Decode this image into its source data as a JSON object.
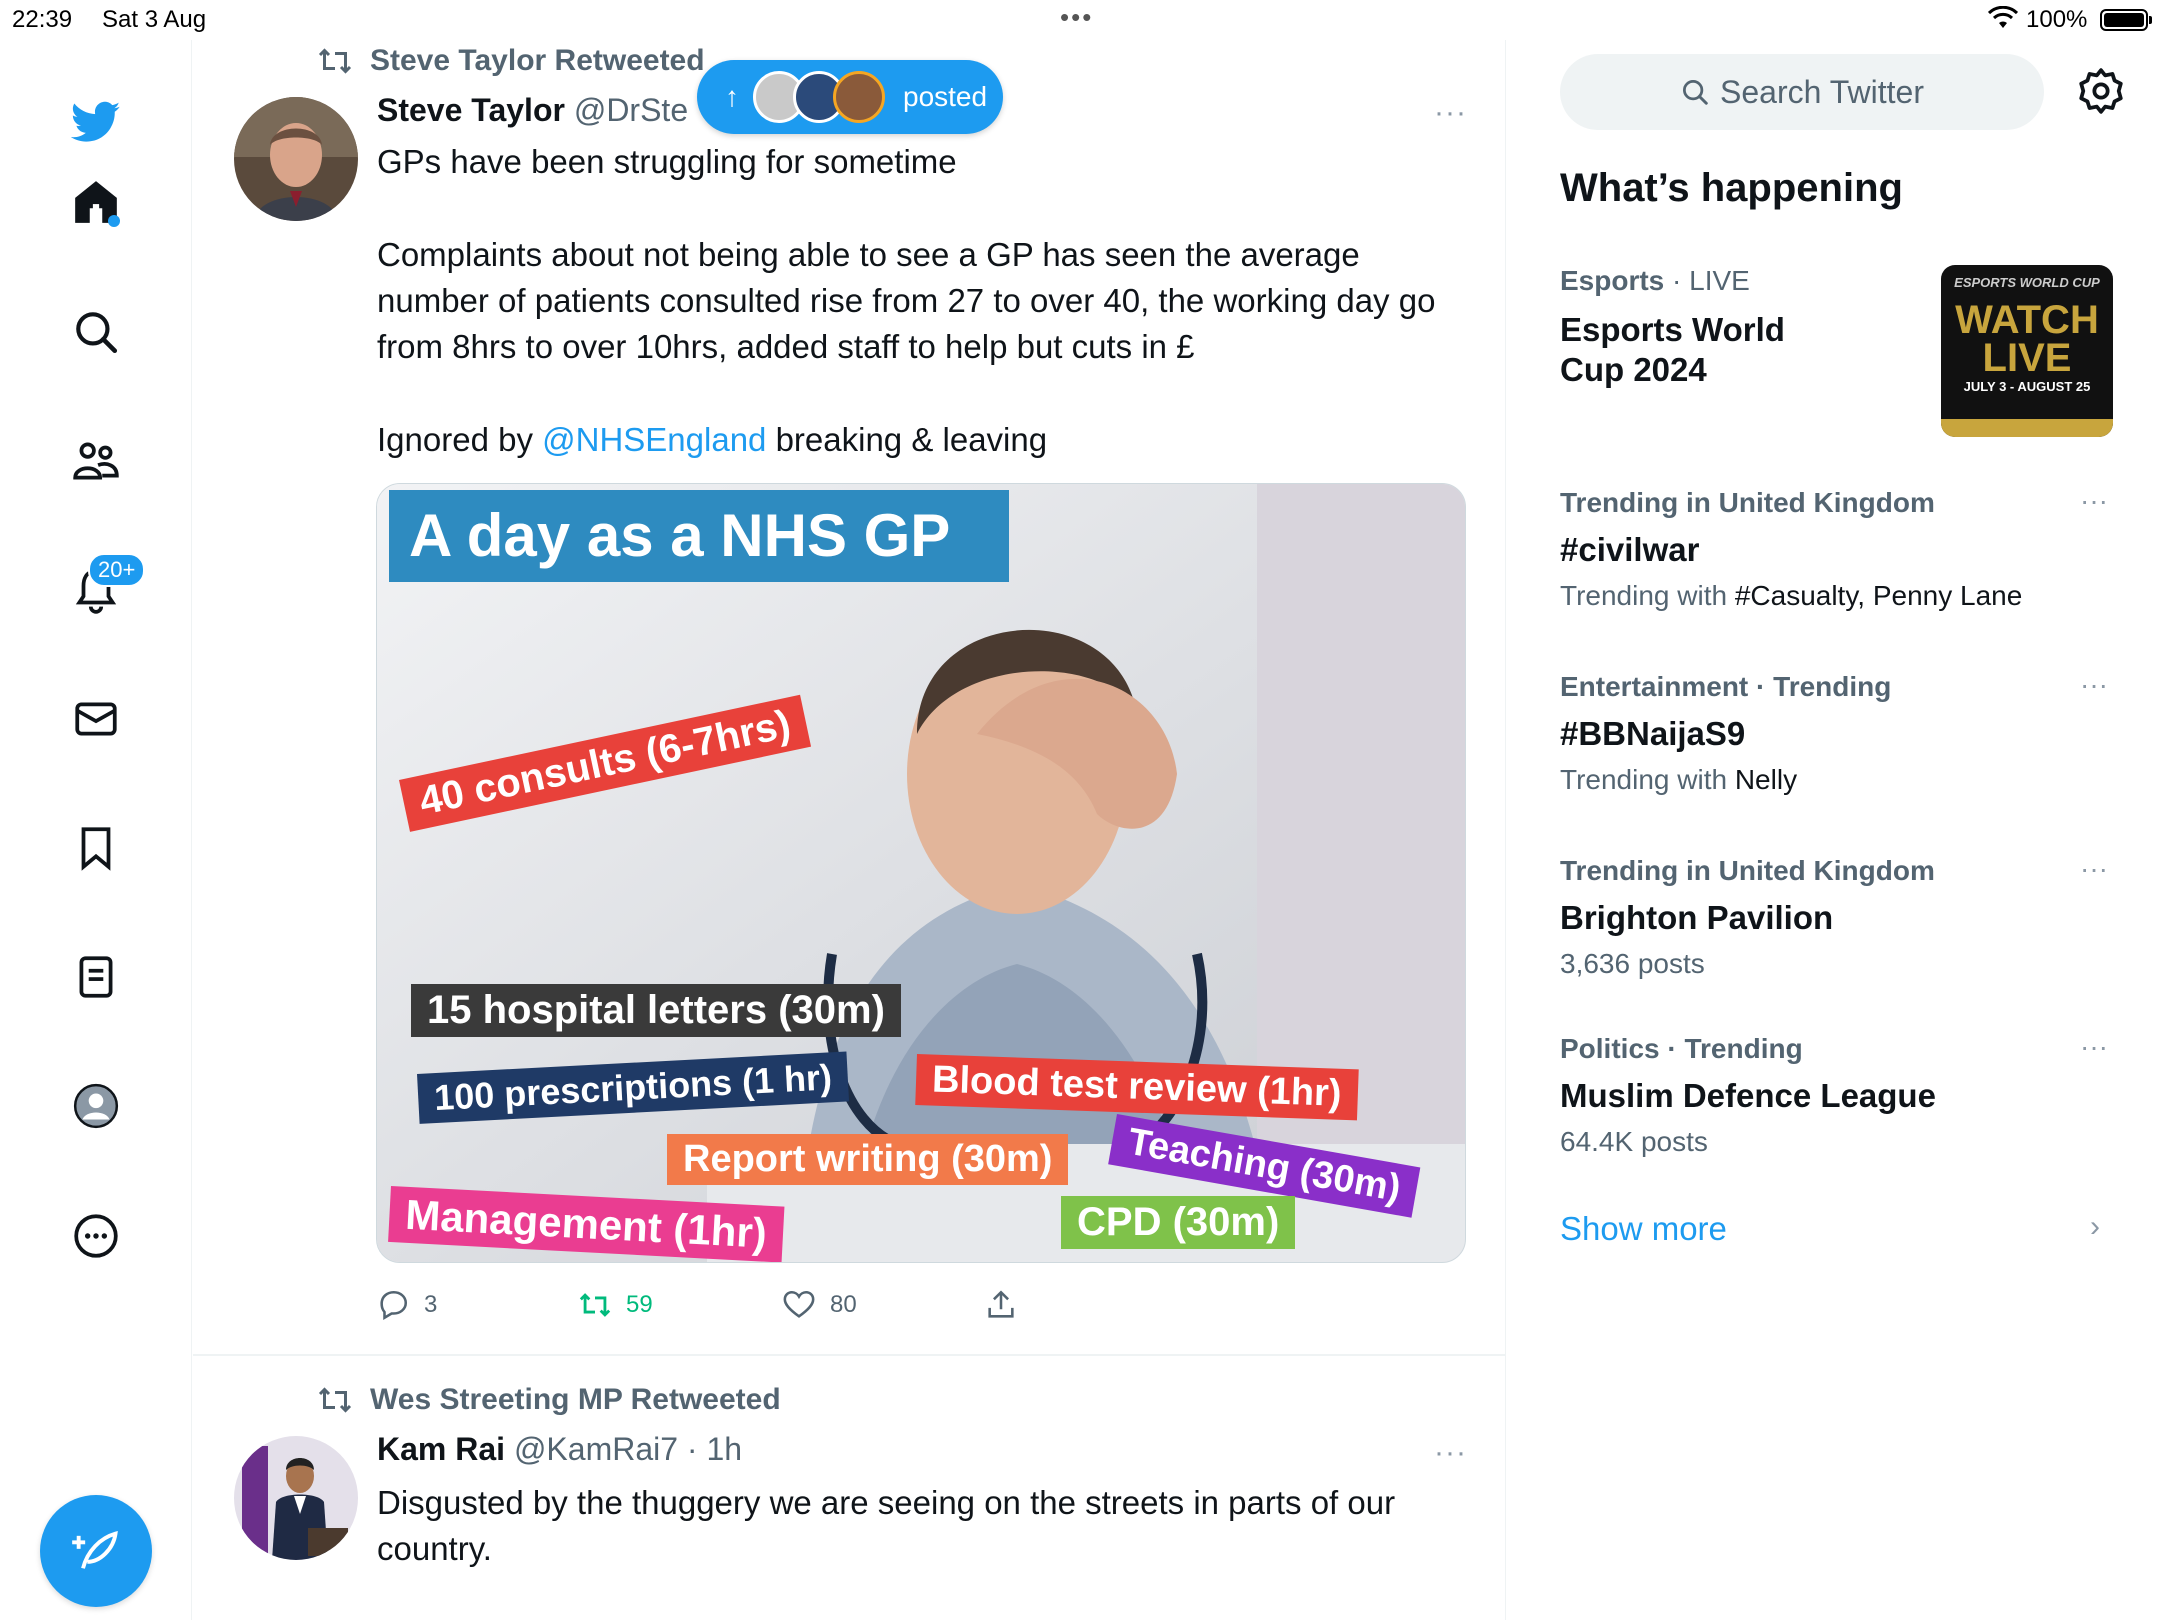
{
  "status_bar": {
    "time": "22:39",
    "date": "Sat 3 Aug",
    "battery": "100%"
  },
  "nav": {
    "notifications_badge": "20+"
  },
  "posted_pill": {
    "label": "posted"
  },
  "tweet1": {
    "retweeted_by": "Steve Taylor Retweeted",
    "name": "Steve Taylor",
    "handle": "@DrSte",
    "more": "···",
    "line1": "GPs have been struggling for sometime",
    "para2": "Complaints about not being able to see a GP has seen the average number of patients consulted rise from 27 to over 40, the working day go from 8hrs to over 10hrs, added staff to help but cuts in £",
    "para3_prefix": "Ignored by ",
    "mention": "@NHSEngland",
    "para3_suffix": " breaking & leaving",
    "image": {
      "title": "A day as a NHS GP",
      "labels": {
        "consults": "40 consults (6-7hrs)",
        "letters": "15 hospital letters (30m)",
        "prescriptions": "100 prescriptions  (1 hr)",
        "blood": "Blood test review (1hr)",
        "report": "Report writing (30m)",
        "teaching": "Teaching (30m)",
        "management": "Management (1hr)",
        "cpd": "CPD (30m)"
      }
    },
    "replies": "3",
    "retweets": "59",
    "likes": "80"
  },
  "tweet2": {
    "retweeted_by": "Wes Streeting MP Retweeted",
    "name": "Kam Rai",
    "handle": "@KamRai7 · 1h",
    "more": "···",
    "text": "Disgusted by the thuggery we are seeing on the streets in parts of our country."
  },
  "sidebar": {
    "search_placeholder": "Search Twitter",
    "heading": "What’s happening",
    "esports": {
      "category": "Esports",
      "status": " · LIVE",
      "title_line1": "Esports World",
      "title_line2": "Cup 2024",
      "thumb_top": "ESPORTS WORLD CUP",
      "thumb_main1": "WATCH",
      "thumb_main2": "LIVE",
      "thumb_dates": "JULY 3 - AUGUST 25"
    },
    "trends": [
      {
        "meta": "Trending in United Kingdom",
        "title": "#civilwar",
        "sub_prefix": "Trending with ",
        "sub_value": "#Casualty, Penny Lane",
        "more": "···"
      },
      {
        "meta": "Entertainment · Trending",
        "title": "#BBNaijaS9",
        "sub_prefix": "Trending with ",
        "sub_value": "Nelly",
        "more": "···"
      },
      {
        "meta": "Trending in United Kingdom",
        "title": "Brighton Pavilion",
        "sub_prefix": "3,636 posts",
        "sub_value": "",
        "more": "···"
      },
      {
        "meta": "Politics · Trending",
        "title": "Muslim Defence League",
        "sub_prefix": "64.4K posts",
        "sub_value": "",
        "more": "···"
      }
    ],
    "show_more": "Show more"
  },
  "colors": {
    "accent": "#1d9bf0",
    "retweet_green": "#00ba7c",
    "muted": "#536471"
  }
}
